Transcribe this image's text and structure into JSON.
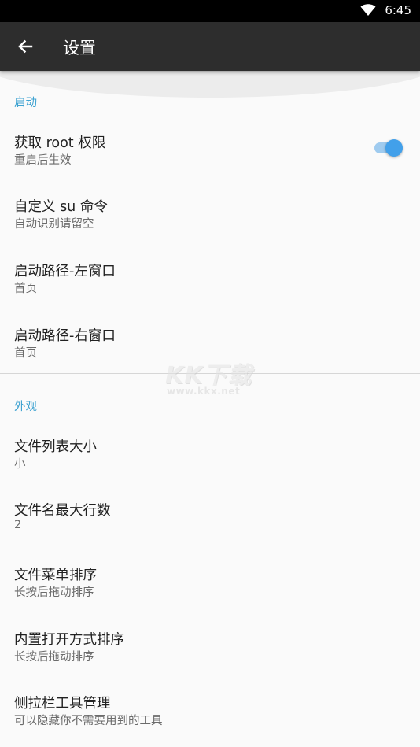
{
  "status_bar": {
    "time": "6:45",
    "icons": [
      "wifi-icon"
    ]
  },
  "app_bar": {
    "back_icon": "arrow-left-icon",
    "title": "设置"
  },
  "sections": [
    {
      "header": "启动",
      "items": [
        {
          "title": "获取 root 权限",
          "summary": "重启后生效",
          "switch": true
        },
        {
          "title": "自定义 su 命令",
          "summary": "自动识别请留空"
        },
        {
          "title": "启动路径-左窗口",
          "summary": "首页"
        },
        {
          "title": "启动路径-右窗口",
          "summary": "首页"
        }
      ]
    },
    {
      "header": "外观",
      "items": [
        {
          "title": "文件列表大小",
          "summary": "小"
        },
        {
          "title": "文件名最大行数",
          "summary": "2"
        },
        {
          "title": "文件菜单排序",
          "summary": "长按后拖动排序"
        },
        {
          "title": "内置打开方式排序",
          "summary": "长按后拖动排序"
        },
        {
          "title": "侧拉栏工具管理",
          "summary": "可以隐藏你不需要用到的工具"
        }
      ]
    }
  ],
  "watermark": {
    "logo": "KK下载",
    "url": "www.kkx.net"
  },
  "colors": {
    "status_bar": "#000000",
    "app_bar": "#2d2d2d",
    "accent": "#3fa3d1",
    "switch_on": "#42a0ea",
    "background": "#fafafa"
  }
}
